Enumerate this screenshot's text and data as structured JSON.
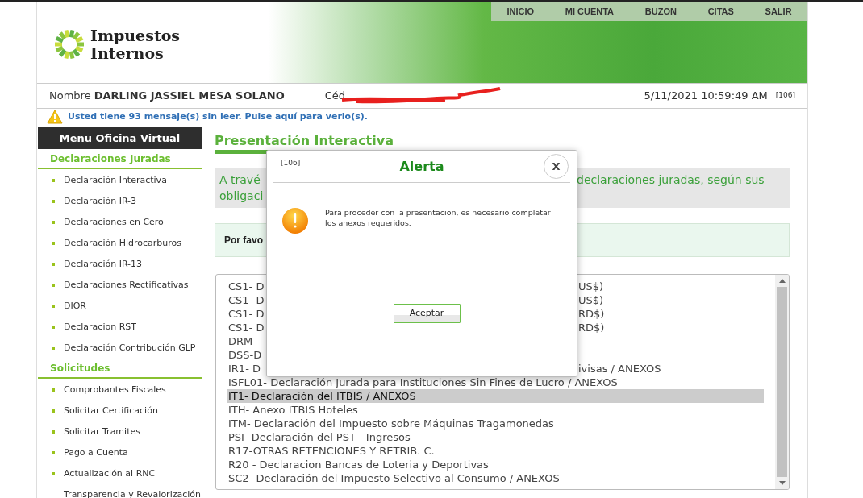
{
  "header": {
    "logo_lines": [
      "Impuestos",
      "Internos"
    ],
    "nav": [
      "INICIO",
      "MI CUENTA",
      "BUZON",
      "CITAS",
      "SALIR"
    ]
  },
  "user_bar": {
    "name_label": "Nombre",
    "name": "DARLING JASSIEL MESA SOLANO",
    "id_label": "Céd",
    "datetime": "5/11/2021 10:59:49 AM",
    "code": "[106]"
  },
  "notice": {
    "text": "Usted tiene 93 mensaje(s) sin leer. Pulse aquí para verlo(s)."
  },
  "sidebar": {
    "title": "Menu Oficina Virtual",
    "sections": [
      {
        "title": "Declaraciones Juradas",
        "items": [
          {
            "label": "Declaración Interactiva",
            "bullet": true
          },
          {
            "label": "Declaración IR-3",
            "bullet": true
          },
          {
            "label": "Declaraciones en Cero",
            "bullet": true
          },
          {
            "label": "Declaración Hidrocarburos",
            "bullet": true
          },
          {
            "label": "Declaración IR-13",
            "bullet": true
          },
          {
            "label": "Declaraciones Rectificativas",
            "bullet": true
          },
          {
            "label": "DIOR",
            "bullet": true
          },
          {
            "label": "Declaracion RST",
            "bullet": true
          },
          {
            "label": "Declaración Contribución GLP",
            "bullet": true
          }
        ]
      },
      {
        "title": "Solicitudes",
        "items": [
          {
            "label": "Comprobantes Fiscales",
            "bullet": true
          },
          {
            "label": "Solicitar Certificación",
            "bullet": true
          },
          {
            "label": "Solicitar Tramites",
            "bullet": true
          },
          {
            "label": "Pago a Cuenta",
            "bullet": true
          },
          {
            "label": "Actualización al RNC",
            "bullet": true
          },
          {
            "label": "Transparencia y Revalorización",
            "bullet": false
          }
        ]
      }
    ]
  },
  "main": {
    "title": "Presentación Interactiva",
    "info": {
      "line1_left": "A travé",
      "line1_right": "declaraciones juradas, según sus",
      "line2_left": "obligaci"
    },
    "prompt": "Por favo",
    "list": {
      "rows": [
        {
          "left": "CS1- D",
          "right": "US$)",
          "selected": false
        },
        {
          "left": "CS1- D",
          "right": "US$)",
          "selected": false
        },
        {
          "left": "CS1- D",
          "right": "RD$)",
          "selected": false
        },
        {
          "left": "CS1- D",
          "right": "RD$)",
          "selected": false
        },
        {
          "left": "DRM -",
          "selected": false
        },
        {
          "left": "DSS-D",
          "selected": false
        },
        {
          "left": "IR1- D",
          "right": "ivisas / ANEXOS",
          "selected": false
        },
        {
          "left": "ISFL01- Declaración Jurada para Instituciones Sin Fines de Lucro / ANEXOS",
          "selected": false
        },
        {
          "left": "IT1- Declaración del ITBIS / ANEXOS",
          "selected": true
        },
        {
          "left": "ITH- Anexo ITBIS Hoteles",
          "selected": false
        },
        {
          "left": "ITM- Declaración del Impuesto sobre Máquinas Tragamonedas",
          "selected": false
        },
        {
          "left": "PSI- Declaración del PST - Ingresos",
          "selected": false
        },
        {
          "left": "R17-OTRAS RETENCIONES Y RETRIB. C.",
          "selected": false
        },
        {
          "left": "R20 - Declaracion Bancas de Loteria y Deportivas",
          "selected": false
        },
        {
          "left": "SC2- Declaración del Impuesto Selectivo al Consumo / ANEXOS",
          "selected": false
        }
      ]
    }
  },
  "dialog": {
    "code": "[106]",
    "title": "Alerta",
    "close": "X",
    "message": "Para proceder con la presentacion, es necesario completar los anexos requeridos.",
    "button": "Aceptar"
  }
}
